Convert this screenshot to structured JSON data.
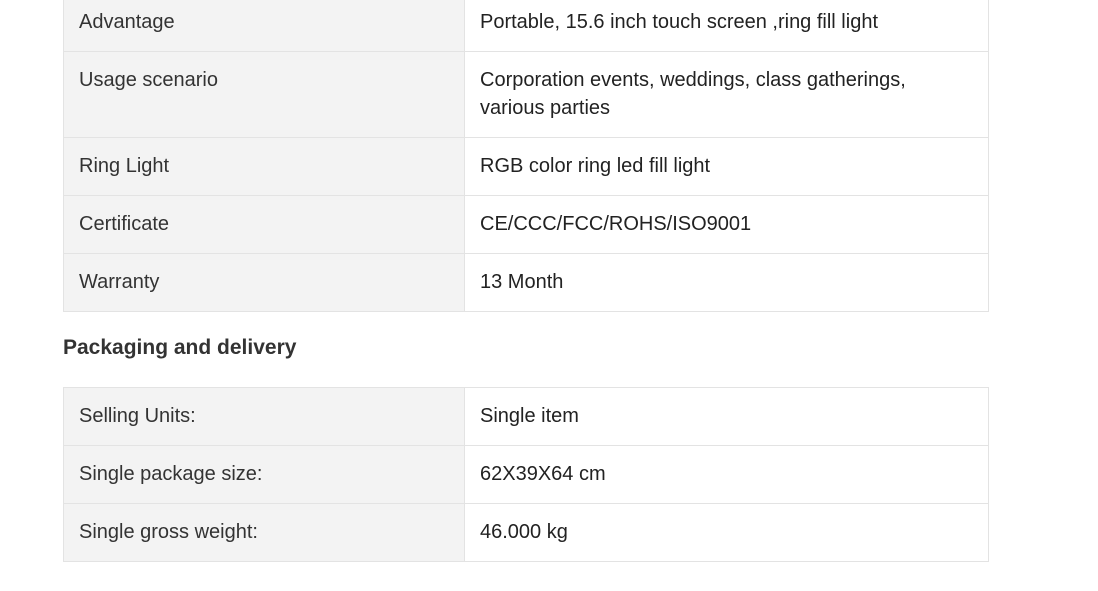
{
  "attributes": [
    {
      "label": "Advantage",
      "value": "Portable, 15.6 inch touch screen ,ring fill light"
    },
    {
      "label": "Usage scenario",
      "value": "Corporation events, weddings, class gatherings, various parties"
    },
    {
      "label": "Ring Light",
      "value": "RGB color ring led fill light"
    },
    {
      "label": "Certificate",
      "value": "CE/CCC/FCC/ROHS/ISO9001"
    },
    {
      "label": "Warranty",
      "value": "13 Month"
    }
  ],
  "packaging": {
    "title": "Packaging and delivery",
    "rows": [
      {
        "label": "Selling Units:",
        "value": "Single item"
      },
      {
        "label": "Single package size:",
        "value": "62X39X64 cm"
      },
      {
        "label": "Single gross weight:",
        "value": "46.000 kg"
      }
    ]
  }
}
